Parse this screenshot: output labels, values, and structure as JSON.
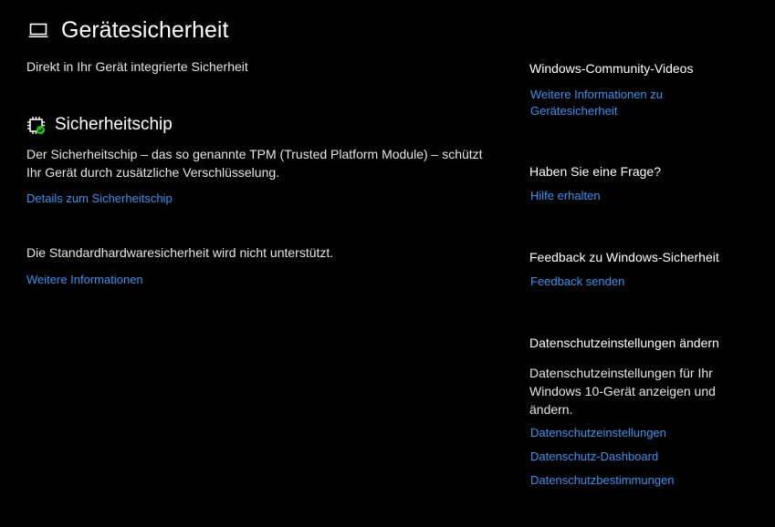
{
  "header": {
    "title": "Gerätesicherheit",
    "subtitle": "Direkt in Ihr Gerät integrierte Sicherheit",
    "icon": "laptop-icon"
  },
  "section": {
    "icon": "security-chip-icon",
    "title": "Sicherheitschip",
    "description": "Der Sicherheitschip – das so genannte TPM (Trusted Platform Module) – schützt Ihr Gerät durch zusätzliche Verschlüsselung.",
    "details_link": "Details zum Sicherheitschip",
    "note": "Die Standardhardwaresicherheit wird nicht unterstützt.",
    "more_link": "Weitere Informationen"
  },
  "sidebar": {
    "videos": {
      "heading": "Windows-Community-Videos",
      "link": "Weitere Informationen zu Gerätesicherheit"
    },
    "question": {
      "heading": "Haben Sie eine Frage?",
      "link": "Hilfe erhalten"
    },
    "feedback": {
      "heading": "Feedback zu Windows-Sicherheit",
      "link": "Feedback senden"
    },
    "privacy": {
      "heading": "Datenschutzeinstellungen ändern",
      "text": "Datenschutzeinstellungen für Ihr Windows 10-Gerät anzeigen und ändern.",
      "links": [
        "Datenschutzeinstellungen",
        "Datenschutz-Dashboard",
        "Datenschutzbestimmungen"
      ]
    }
  },
  "colors": {
    "background": "#000000",
    "link": "#3794f0",
    "text": "#ffffff",
    "status_ok": "#16c60c"
  }
}
